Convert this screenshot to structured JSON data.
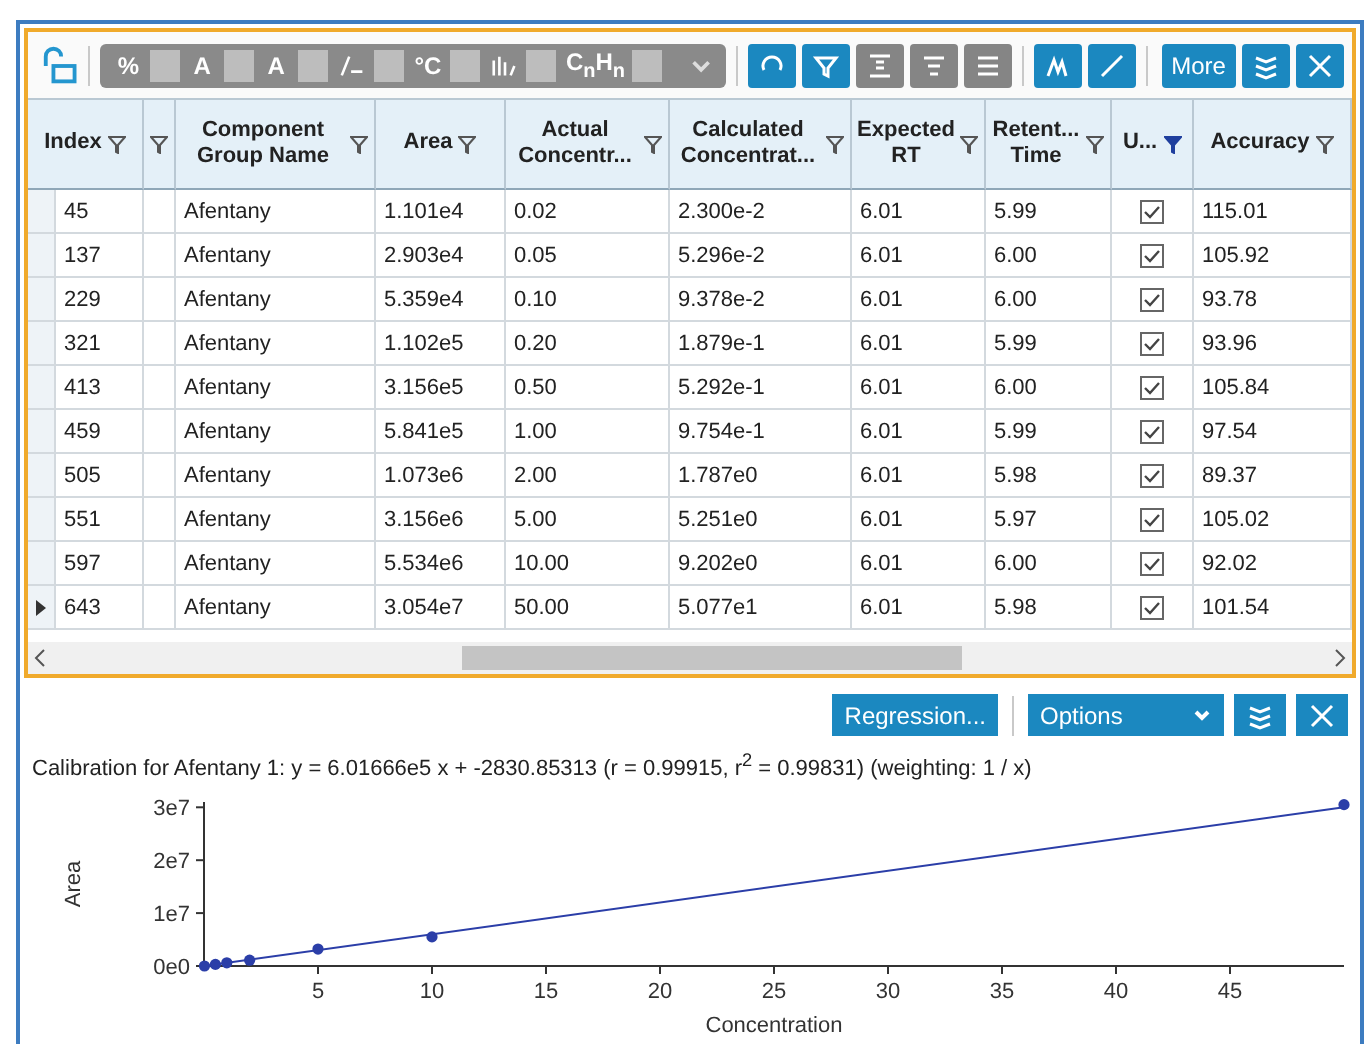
{
  "toolbar": {
    "format_items": [
      {
        "kind": "text",
        "symbol": "%"
      },
      {
        "kind": "text",
        "symbol": "A"
      },
      {
        "kind": "text",
        "symbol": "A"
      },
      {
        "kind": "slash"
      },
      {
        "kind": "text",
        "symbol": "°C"
      },
      {
        "kind": "bars"
      },
      {
        "kind": "text",
        "symbol": "C$_{n}$H$_{n}$"
      }
    ],
    "buttons": [
      {
        "kind": "refresh",
        "color": "#1b88c0"
      },
      {
        "kind": "filter",
        "color": "#1b88c0"
      },
      {
        "kind": "align-top",
        "color": "#858585"
      },
      {
        "kind": "align-middle",
        "color": "#858585"
      },
      {
        "kind": "align-justify",
        "color": "#858585"
      },
      {
        "kind": "peak",
        "color": "#1b88c0"
      },
      {
        "kind": "line",
        "color": "#1b88c0"
      },
      {
        "kind": "more",
        "label": "More",
        "color": "#1b88c0"
      },
      {
        "kind": "layers",
        "color": "#1b88c0"
      },
      {
        "kind": "close",
        "color": "#1b88c0"
      }
    ]
  },
  "table": {
    "columns": [
      {
        "label": "Index",
        "filter_active": false
      },
      {
        "filter_active": false
      },
      {
        "label": "Component Group Name",
        "filter_active": false
      },
      {
        "label": "Area",
        "filter_active": false
      },
      {
        "label": "Actual Concentr...",
        "filter_active": false
      },
      {
        "label": "Calculated Concentrat...",
        "filter_active": false
      },
      {
        "label": "Expected RT",
        "filter_active": false
      },
      {
        "label": "Retent... Time",
        "filter_active": false
      },
      {
        "label": "U...",
        "filter_active": true
      },
      {
        "label": "Accuracy",
        "filter_active": false
      }
    ],
    "rows": [
      {
        "current": false,
        "index": "45",
        "component": "Afentany",
        "area": "1.101e4",
        "actual": "0.02",
        "calculated": "2.300e-2",
        "expected_rt": "6.01",
        "retention": "5.99",
        "used": true,
        "accuracy": "115.01"
      },
      {
        "current": false,
        "index": "137",
        "component": "Afentany",
        "area": "2.903e4",
        "actual": "0.05",
        "calculated": "5.296e-2",
        "expected_rt": "6.01",
        "retention": "6.00",
        "used": true,
        "accuracy": "105.92"
      },
      {
        "current": false,
        "index": "229",
        "component": "Afentany",
        "area": "5.359e4",
        "actual": "0.10",
        "calculated": "9.378e-2",
        "expected_rt": "6.01",
        "retention": "6.00",
        "used": true,
        "accuracy": "93.78"
      },
      {
        "current": false,
        "index": "321",
        "component": "Afentany",
        "area": "1.102e5",
        "actual": "0.20",
        "calculated": "1.879e-1",
        "expected_rt": "6.01",
        "retention": "5.99",
        "used": true,
        "accuracy": "93.96"
      },
      {
        "current": false,
        "index": "413",
        "component": "Afentany",
        "area": "3.156e5",
        "actual": "0.50",
        "calculated": "5.292e-1",
        "expected_rt": "6.01",
        "retention": "6.00",
        "used": true,
        "accuracy": "105.84"
      },
      {
        "current": false,
        "index": "459",
        "component": "Afentany",
        "area": "5.841e5",
        "actual": "1.00",
        "calculated": "9.754e-1",
        "expected_rt": "6.01",
        "retention": "5.99",
        "used": true,
        "accuracy": "97.54"
      },
      {
        "current": false,
        "index": "505",
        "component": "Afentany",
        "area": "1.073e6",
        "actual": "2.00",
        "calculated": "1.787e0",
        "expected_rt": "6.01",
        "retention": "5.98",
        "used": true,
        "accuracy": "89.37"
      },
      {
        "current": false,
        "index": "551",
        "component": "Afentany",
        "area": "3.156e6",
        "actual": "5.00",
        "calculated": "5.251e0",
        "expected_rt": "6.01",
        "retention": "5.97",
        "used": true,
        "accuracy": "105.02"
      },
      {
        "current": false,
        "index": "597",
        "component": "Afentany",
        "area": "5.534e6",
        "actual": "10.00",
        "calculated": "9.202e0",
        "expected_rt": "6.01",
        "retention": "6.00",
        "used": true,
        "accuracy": "92.02"
      },
      {
        "current": true,
        "index": "643",
        "component": "Afentany",
        "area": "3.054e7",
        "actual": "50.00",
        "calculated": "5.077e1",
        "expected_rt": "6.01",
        "retention": "5.98",
        "used": true,
        "accuracy": "101.54"
      }
    ]
  },
  "chart_panel": {
    "regression_button": "Regression...",
    "options_dropdown": "Options",
    "chart_data": {
      "type": "scatter",
      "title": "Calibration for Afentany 1: y = 6.01666e5 x + -2830.85313 (r = 0.99915, r$^{2}$ = 0.99831)  (weighting: 1 / x)",
      "xlabel": "Concentration",
      "ylabel": "Area",
      "xlim": [
        0,
        50
      ],
      "ylim": [
        0,
        31000000
      ],
      "xticks": [
        5,
        10,
        15,
        20,
        25,
        30,
        35,
        40,
        45
      ],
      "yticks": [
        {
          "value": 0,
          "label": "0e0"
        },
        {
          "value": 10000000,
          "label": "1e7"
        },
        {
          "value": 20000000,
          "label": "2e7"
        },
        {
          "value": 30000000,
          "label": "3e7"
        }
      ],
      "series": [
        {
          "type": "scatter",
          "color": "#2b3ea8",
          "x": [
            0.02,
            0.5,
            1,
            2,
            5,
            10,
            50
          ],
          "values": [
            0,
            300000,
            600000,
            1100000,
            3200000,
            5500000,
            30500000
          ]
        },
        {
          "type": "line",
          "color": "#2b3ea8",
          "x": [
            0,
            50
          ],
          "values": [
            0,
            30000000
          ]
        }
      ]
    }
  }
}
